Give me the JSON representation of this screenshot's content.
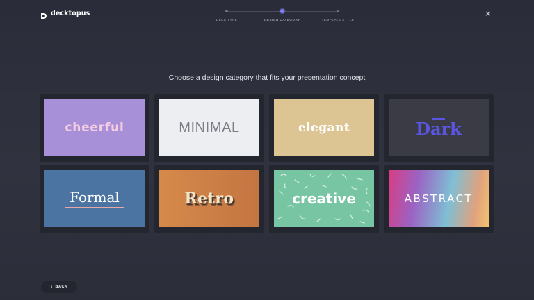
{
  "app": {
    "name": "decktopus",
    "logo_icon": "decktopus-logo-icon"
  },
  "close": {
    "label": "×",
    "icon": "close-icon"
  },
  "stepper": {
    "steps": [
      {
        "label": "DECK TYPE",
        "state": "complete"
      },
      {
        "label": "DESIGN CATEGORY",
        "state": "active"
      },
      {
        "label": "TEMPLATE STYLE",
        "state": "upcoming"
      }
    ]
  },
  "heading": "Choose a design category that fits your presentation concept",
  "categories": [
    {
      "key": "cheerful",
      "label": "cheerful"
    },
    {
      "key": "minimal",
      "label": "MINIMAL"
    },
    {
      "key": "elegant",
      "label": "elegant"
    },
    {
      "key": "dark",
      "label": "Dark"
    },
    {
      "key": "formal",
      "label": "Formal"
    },
    {
      "key": "retro",
      "label": "Retro"
    },
    {
      "key": "creative",
      "label": "creative"
    },
    {
      "key": "abstract",
      "label": "ABSTRACT"
    }
  ],
  "back": {
    "label": "BACK",
    "icon": "chevron-left-icon"
  },
  "colors": {
    "background": "#2d2f3c",
    "accent": "#7f7ff2",
    "card_frame": "#23252f"
  }
}
